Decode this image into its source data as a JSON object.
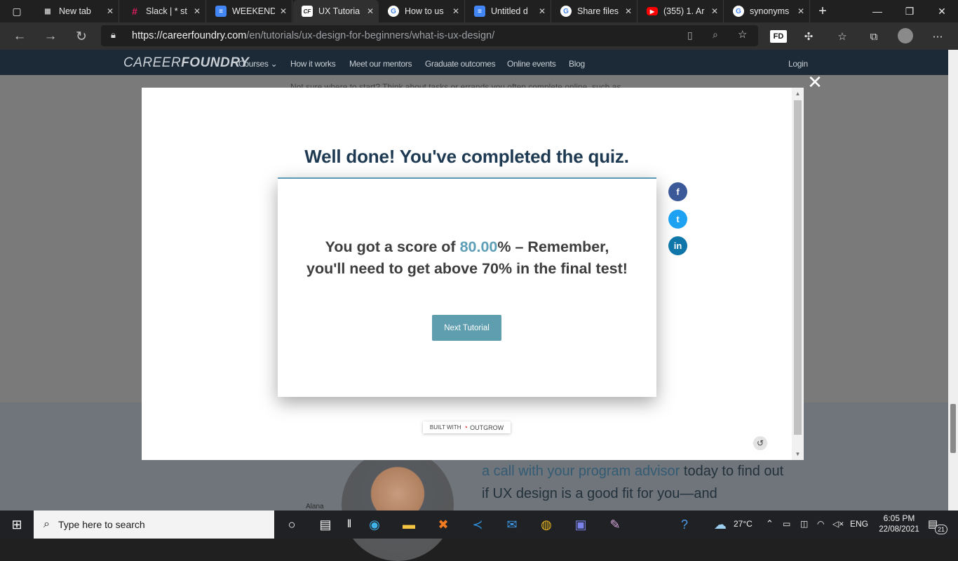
{
  "browser": {
    "tabs": [
      {
        "label": "New tab",
        "icon": "new-tab-icon",
        "color": "#5a5a5a"
      },
      {
        "label": "Slack | * st",
        "icon": "slack-icon",
        "color": "#4a154b"
      },
      {
        "label": "WEEKEND",
        "icon": "docs-icon",
        "color": "#4285f4"
      },
      {
        "label": "UX Tutoria",
        "icon": "careerfoundry-icon",
        "color": "#2b2b2b"
      },
      {
        "label": "How to us",
        "icon": "google-icon",
        "color": "#ffffff"
      },
      {
        "label": "Untitled d",
        "icon": "docs-icon",
        "color": "#4285f4"
      },
      {
        "label": "Share files",
        "icon": "google-icon",
        "color": "#ffffff"
      },
      {
        "label": "(355) 1. Ar",
        "icon": "youtube-icon",
        "color": "#ff0000"
      },
      {
        "label": "synonyms",
        "icon": "google-icon",
        "color": "#ffffff"
      }
    ],
    "active_tab_index": 3,
    "url_host": "https://careerfoundry.com",
    "url_path": "/en/tutorials/ux-design-for-beginners/what-is-ux-design/",
    "profile_badge": "FD"
  },
  "site": {
    "logo_light": "CAREER",
    "logo_bold": "FOUNDRY",
    "nav": [
      "Courses ⌄",
      "How it works",
      "Meet our mentors",
      "Graduate outcomes",
      "Online events",
      "Blog"
    ],
    "login": "Login",
    "ghost_text": "Not sure where to start? Think about tasks or errands you often complete online, such as",
    "promo_link": "a call with your program advisor",
    "promo_rest": " today to find out if UX design is a good fit for you—and",
    "avatar_name": "Alana"
  },
  "modal": {
    "title": "Well done! You've completed the quiz.",
    "score_prefix": "You got a score of ",
    "score_value": "80.00",
    "score_suffix": "%  – Remember, you'll need to get above 70% in the final test!",
    "next_button": "Next Tutorial",
    "built_with": "BUILT WITH",
    "brand": "OUTGROW",
    "share": [
      {
        "icon": "facebook-icon",
        "glyph": "f",
        "color": "#3b5998"
      },
      {
        "icon": "twitter-icon",
        "glyph": "t",
        "color": "#1da1f2"
      },
      {
        "icon": "linkedin-icon",
        "glyph": "in",
        "color": "#0e76a8"
      }
    ]
  },
  "taskbar": {
    "search_placeholder": "Type here to search",
    "weather": "27°C",
    "language": "ENG",
    "time": "6:05 PM",
    "date": "22/08/2021",
    "notification_count": "21"
  }
}
